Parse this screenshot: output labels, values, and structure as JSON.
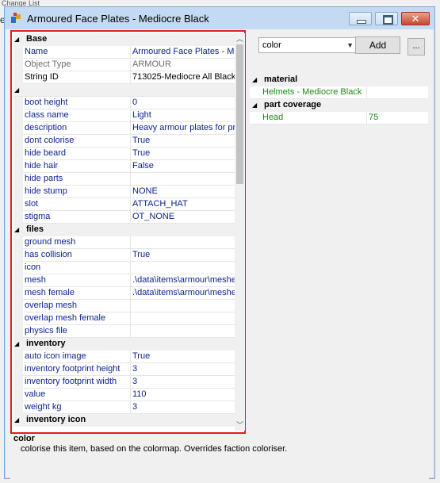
{
  "background": {
    "title_snippet": "Change List",
    "side_char": "e"
  },
  "window": {
    "title": "Armoured Face Plates - Mediocre Black",
    "controls": {
      "minimize": "",
      "maximize": "",
      "close": "✕"
    }
  },
  "property_grid": {
    "rows": [
      {
        "type": "category",
        "toggle": "◢",
        "name": "Base"
      },
      {
        "type": "prop",
        "style": "normal",
        "key": "Name",
        "value": "Armoured Face Plates - Mediocre Black"
      },
      {
        "type": "prop",
        "style": "readonly",
        "key": "Object Type",
        "value": "ARMOUR"
      },
      {
        "type": "prop",
        "style": "readonly-dark",
        "key": "String ID",
        "value": "713025-Mediocre All Black"
      },
      {
        "type": "spacer",
        "toggle": "◢"
      },
      {
        "type": "prop",
        "style": "normal",
        "key": "boot height",
        "value": "0"
      },
      {
        "type": "prop",
        "style": "normal",
        "key": "class name",
        "value": "Light"
      },
      {
        "type": "prop",
        "style": "normal",
        "key": "description",
        "value": "Heavy armour plates for protection"
      },
      {
        "type": "prop",
        "style": "normal",
        "key": "dont colorise",
        "value": "True"
      },
      {
        "type": "prop",
        "style": "normal",
        "key": "hide beard",
        "value": "True"
      },
      {
        "type": "prop",
        "style": "normal",
        "key": "hide hair",
        "value": "False"
      },
      {
        "type": "prop",
        "style": "normal",
        "key": "hide parts",
        "value": ""
      },
      {
        "type": "prop",
        "style": "normal",
        "key": "hide stump",
        "value": "NONE"
      },
      {
        "type": "prop",
        "style": "normal",
        "key": "slot",
        "value": "ATTACH_HAT"
      },
      {
        "type": "prop",
        "style": "normal",
        "key": "stigma",
        "value": "OT_NONE"
      },
      {
        "type": "category",
        "toggle": "◢",
        "name": "files"
      },
      {
        "type": "prop",
        "style": "normal",
        "key": "ground mesh",
        "value": ""
      },
      {
        "type": "prop",
        "style": "normal",
        "key": "has collision",
        "value": "True"
      },
      {
        "type": "prop",
        "style": "normal",
        "key": "icon",
        "value": ""
      },
      {
        "type": "prop",
        "style": "normal",
        "key": "mesh",
        "value": ".\\data\\items\\armour\\meshes"
      },
      {
        "type": "prop",
        "style": "normal",
        "key": "mesh female",
        "value": ".\\data\\items\\armour\\meshes"
      },
      {
        "type": "prop",
        "style": "normal",
        "key": "overlap mesh",
        "value": ""
      },
      {
        "type": "prop",
        "style": "normal",
        "key": "overlap mesh female",
        "value": ""
      },
      {
        "type": "prop",
        "style": "normal",
        "key": "physics file",
        "value": ""
      },
      {
        "type": "category",
        "toggle": "◢",
        "name": "inventory"
      },
      {
        "type": "prop",
        "style": "normal",
        "key": "auto icon image",
        "value": "True"
      },
      {
        "type": "prop",
        "style": "normal",
        "key": "inventory footprint height",
        "value": "3"
      },
      {
        "type": "prop",
        "style": "normal",
        "key": "inventory footprint width",
        "value": "3"
      },
      {
        "type": "prop",
        "style": "normal",
        "key": "value",
        "value": "110"
      },
      {
        "type": "prop",
        "style": "normal",
        "key": "weight kg",
        "value": "3"
      },
      {
        "type": "category",
        "toggle": "◢",
        "name": "inventory icon"
      }
    ],
    "scroll": {
      "up": "︿",
      "down": "﹀"
    }
  },
  "right_panel": {
    "combo_value": "color",
    "combo_arrow": "▼",
    "add_label": "Add",
    "more_label": "...",
    "tree": [
      {
        "type": "category",
        "toggle": "◢",
        "name": "material"
      },
      {
        "type": "item",
        "key": "Helmets - Mediocre Black",
        "value": ""
      },
      {
        "type": "category",
        "toggle": "◢",
        "name": "part coverage"
      },
      {
        "type": "item",
        "key": "Head",
        "value": "75"
      }
    ]
  },
  "description": {
    "title": "color",
    "text": "colorise this item, based on the colormap. Overrides faction coloriser."
  },
  "colors": {
    "title_bar": "#c4daf2",
    "highlight_border": "#d9211e",
    "property_text": "#0b1f8c",
    "tree_text": "#1a8a12"
  }
}
